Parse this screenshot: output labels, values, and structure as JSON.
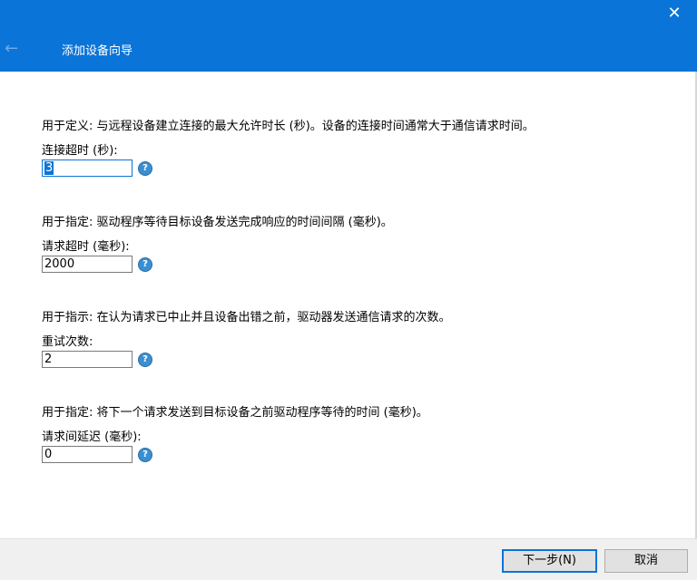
{
  "header": {
    "title": "添加设备向导",
    "back_glyph": "←",
    "close_glyph": "✕"
  },
  "settings": [
    {
      "description": "用于定义: 与远程设备建立连接的最大允许时长 (秒)。设备的连接时间通常大于通信请求时间。",
      "label": "连接超时 (秒):",
      "value": "3"
    },
    {
      "description": "用于指定: 驱动程序等待目标设备发送完成响应的时间间隔 (毫秒)。",
      "label": "请求超时 (毫秒):",
      "value": "2000"
    },
    {
      "description": "用于指示: 在认为请求已中止并且设备出错之前，驱动器发送通信请求的次数。",
      "label": "重试次数:",
      "value": "2"
    },
    {
      "description": "用于指定: 将下一个请求发送到目标设备之前驱动程序等待的时间 (毫秒)。",
      "label": "请求间延迟 (毫秒):",
      "value": "0"
    }
  ],
  "help_glyph": "?",
  "footer": {
    "next_label": "下一步(N)",
    "cancel_label": "取消"
  },
  "colors": {
    "accent": "#0a74d8",
    "help_icon": "#3b8fd0"
  }
}
